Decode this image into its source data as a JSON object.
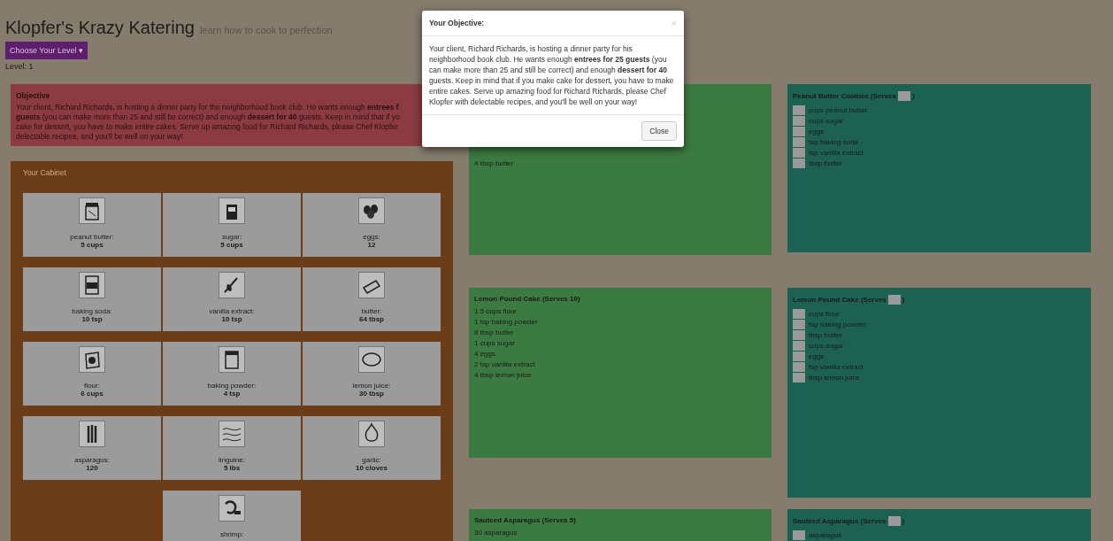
{
  "header": {
    "title": "Klopfer's Krazy Katering",
    "subtitle": "learn how to cook to perfection",
    "level_button": "Choose Your Level ▾",
    "level": "Level: 1"
  },
  "objective": {
    "title": "Objective",
    "lines": [
      "Your client, Richard Richards, is hosting a dinner party for the neighborhood book club. He wants enough **entrees f**",
      "**guests** (you can make more than 25 and still be correct) and enough **dessert for 40** guests. Keep in mind that if yo",
      "cake for dessert, you have to make entire cakes. Serve up amazing food for Richard Richards, please Chef Klopfer",
      "delectable recipes, and you'll be well on your way!"
    ]
  },
  "cabinet": {
    "title": "Your Cabinet",
    "items": [
      {
        "name": "peanut butter:",
        "amount": "5 cups"
      },
      {
        "name": "sugar:",
        "amount": "5 cups"
      },
      {
        "name": "eggs:",
        "amount": "12"
      },
      {
        "name": "baking soda:",
        "amount": "10 tsp"
      },
      {
        "name": "vanilla extract:",
        "amount": "10 tsp"
      },
      {
        "name": "butter:",
        "amount": "64 tbsp"
      },
      {
        "name": "flour:",
        "amount": "6 cups"
      },
      {
        "name": "baking powder:",
        "amount": "4 tsp"
      },
      {
        "name": "lemon juice:",
        "amount": "30 tbsp"
      },
      {
        "name": "asparagus:",
        "amount": "120"
      },
      {
        "name": "linguine:",
        "amount": "5 lbs"
      },
      {
        "name": "garlic:",
        "amount": "10 cloves"
      },
      {
        "name": "shrimp:"
      }
    ]
  },
  "recipes": [
    {
      "items": [
        "4 tbsp butter"
      ]
    },
    {
      "title": "Lemon Pound Cake (Serves 10)",
      "items": [
        "1.5 cups flour",
        "1 tsp baking powder",
        "8 tbsp butter",
        "1 cups sugar",
        "4 eggs",
        "2 tsp vanilla extract",
        "4 tbsp lemon juice"
      ]
    },
    {
      "title": "Sauteed Asparagus (Serves 5)",
      "items": [
        "30 asparagus"
      ]
    }
  ],
  "worksheets": [
    {
      "title": "Peanut Butter Cookies (Serves",
      "close": ")",
      "items": [
        "cups peanut butter",
        "cups sugar",
        "eggs",
        "tsp baking soda",
        "tsp vanilla extract",
        "tbsp butter"
      ]
    },
    {
      "title": "Lemon Pound Cake (Serves",
      "close": ")",
      "items": [
        "cups flour",
        "tsp baking powder",
        "tbsp butter",
        "cups sugar",
        "eggs",
        "tsp vanilla extract",
        "tbsp lemon juice"
      ]
    },
    {
      "title": "Sauteed Asparagus (Serves",
      "close": ")",
      "items": [
        "asparagus"
      ]
    }
  ],
  "modal": {
    "title": "Your Objective:",
    "close_icon": "×",
    "body": "Your client, Richard Richards, is hosting a dinner party for his neighborhood book club. He wants enough **entrees for 25 guests** (you can make more than 25 and still be correct) and enough **dessert for 40** guests. Keep in mind that if you make cake for dessert, you have to make entire cakes. Serve up amazing food for Richard Richards, please Chef Klopfer with delectable recipes, and you'll be well on your way!",
    "button": "Close"
  }
}
